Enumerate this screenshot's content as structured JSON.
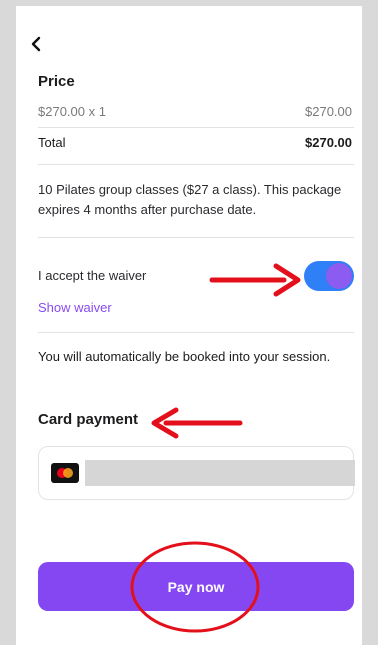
{
  "header": {
    "back_icon": "chevron-left-icon"
  },
  "price_section": {
    "heading": "Price",
    "line_item": {
      "label": "$270.00 x 1",
      "amount": "$270.00"
    },
    "total": {
      "label": "Total",
      "amount": "$270.00"
    }
  },
  "package": {
    "description": "10 Pilates group classes ($27 a class). This package expires 4 months after purchase date."
  },
  "waiver": {
    "label": "I accept the waiver",
    "accepted": true,
    "show_link": "Show waiver"
  },
  "booking_note": "You will automatically be booked into your session.",
  "card_payment": {
    "heading": "Card payment",
    "card_brand_icon": "mastercard-icon"
  },
  "pay_button": {
    "label": "Pay now"
  },
  "colors": {
    "accent": "#8547f2",
    "toggle_on": "#2f7ff6",
    "annotation": "#e3101b",
    "link": "#8a4cf0"
  }
}
